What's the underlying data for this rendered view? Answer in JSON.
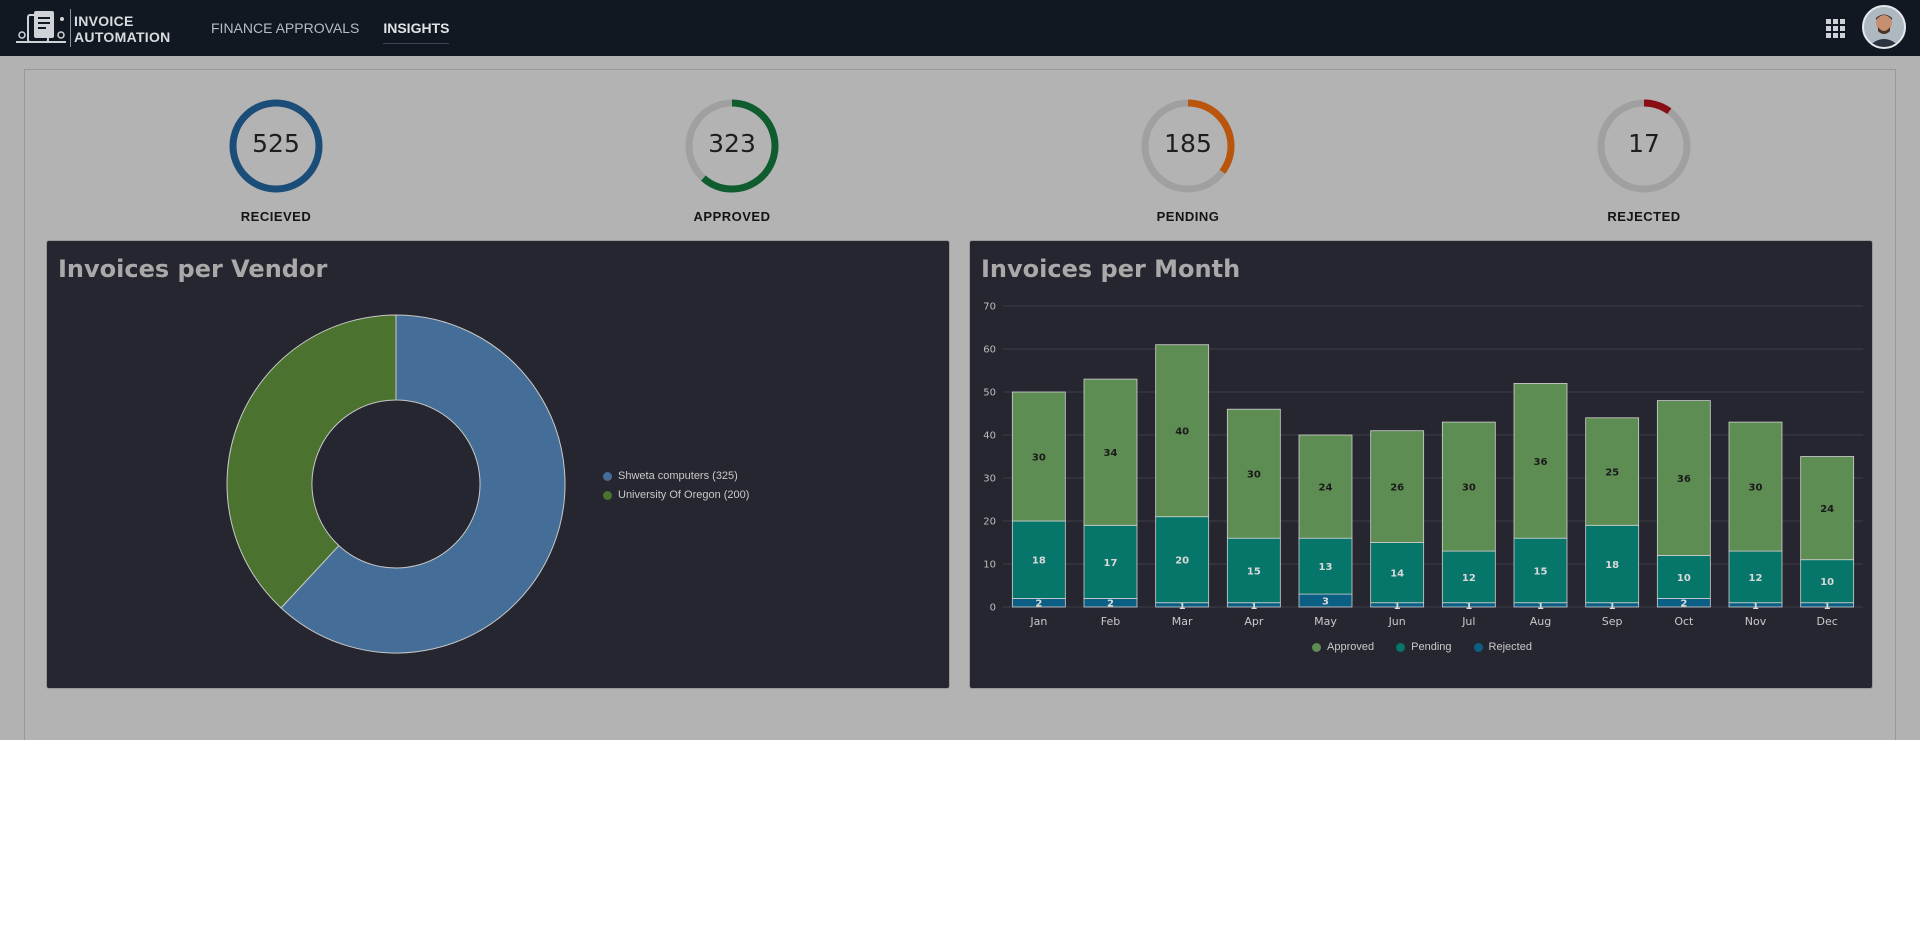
{
  "header": {
    "logo_line1": "INVOICE",
    "logo_line2": "AUTOMATION",
    "nav": [
      {
        "label": "FINANCE APPROVALS",
        "active": false
      },
      {
        "label": "INSIGHTS",
        "active": true
      }
    ],
    "apps_icon": "grid-icon",
    "avatar": "user-avatar"
  },
  "stats": [
    {
      "value": "525",
      "label": "RECIEVED",
      "fraction": 1.0,
      "color": "#1a4d78"
    },
    {
      "value": "323",
      "label": "APPROVED",
      "fraction": 0.615,
      "color": "#0f5c2e"
    },
    {
      "value": "185",
      "label": "PENDING",
      "fraction": 0.352,
      "color": "#b9550d"
    },
    {
      "value": "17",
      "label": "REJECTED",
      "fraction": 0.1,
      "color": "#8a0f14"
    }
  ],
  "vendor_card": {
    "title": "Invoices per Vendor",
    "legend": [
      "Shweta computers (325)",
      "University Of Oregon (200)"
    ]
  },
  "month_card": {
    "title": "Invoices per Month"
  },
  "chart_data": [
    {
      "type": "pie",
      "title": "Invoices per Vendor",
      "donut": true,
      "labels": [
        "Shweta computers",
        "University Of Oregon"
      ],
      "values": [
        325,
        200
      ],
      "colors": [
        "#446e97",
        "#4b722f"
      ],
      "legend": "right"
    },
    {
      "type": "bar",
      "stacked": true,
      "title": "Invoices per Month",
      "categories": [
        "Jan",
        "Feb",
        "Mar",
        "Apr",
        "May",
        "Jun",
        "Jul",
        "Aug",
        "Sep",
        "Oct",
        "Nov",
        "Dec"
      ],
      "series": [
        {
          "name": "Rejected",
          "values": [
            2,
            2,
            1,
            1,
            3,
            1,
            1,
            1,
            1,
            2,
            1,
            1
          ],
          "color": "#0c5f84"
        },
        {
          "name": "Pending",
          "values": [
            18,
            17,
            20,
            15,
            13,
            14,
            12,
            15,
            18,
            10,
            12,
            10
          ],
          "color": "#06756a"
        },
        {
          "name": "Approved",
          "values": [
            30,
            34,
            40,
            30,
            24,
            26,
            30,
            36,
            25,
            36,
            30,
            24
          ],
          "color": "#5e8d54"
        }
      ],
      "ylim": [
        0,
        70
      ],
      "yticks": [
        0,
        10,
        20,
        30,
        40,
        50,
        60,
        70
      ],
      "grid": true,
      "legend": "bottom"
    }
  ]
}
